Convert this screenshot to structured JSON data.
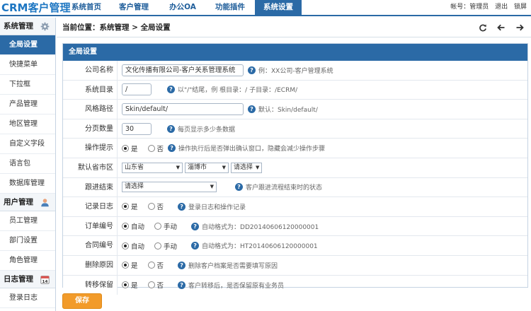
{
  "app": {
    "logo": "CRM客户管理"
  },
  "nav": {
    "tabs": [
      {
        "label": "系统首页"
      },
      {
        "label": "客户管理"
      },
      {
        "label": "办公OA"
      },
      {
        "label": "功能插件"
      },
      {
        "label": "系统设置",
        "active": true
      }
    ]
  },
  "user": {
    "account": "帐号：管理员",
    "logout": "退出",
    "lock": "锁屏"
  },
  "sidebar": {
    "groups": [
      {
        "title": "系统管理",
        "icon": "gear-icon",
        "items": [
          "全局设置",
          "快捷菜单",
          "下拉框",
          "产品管理",
          "地区管理",
          "自定义字段",
          "语言包",
          "数据库管理"
        ]
      },
      {
        "title": "用户管理",
        "icon": "user-icon",
        "items": [
          "员工管理",
          "部门设置",
          "角色管理"
        ]
      },
      {
        "title": "日志管理",
        "icon": "calendar-icon",
        "items": [
          "登录日志"
        ]
      }
    ],
    "active_item": "全局设置",
    "calendar_day": "14"
  },
  "breadcrumb": "当前位置：系统管理 > 全局设置",
  "panel": {
    "title": "全局设置",
    "rows": {
      "company": {
        "label": "公司名称",
        "value": "文化传播有限公司-客户关系管理系统",
        "hint": "例：XX公司-客户管理系统"
      },
      "sysdir": {
        "label": "系统目录",
        "value": "/",
        "hint": "以\"/\"结尾，例 根目录：/    子目录：/ECRM/"
      },
      "style": {
        "label": "风格路径",
        "value": "Skin/default/",
        "hint": "默认：Skin/default/"
      },
      "paging": {
        "label": "分页数量",
        "value": "30",
        "hint": "每页显示多少条数据"
      },
      "confirm": {
        "label": "操作提示",
        "yes": "是",
        "no": "否",
        "selected": "是",
        "hint": "操作执行后是否弹出确认窗口，隐藏会减少操作步骤"
      },
      "region": {
        "label": "默认省市区",
        "province": "山东省",
        "city": "淄博市",
        "district": "请选择"
      },
      "followup": {
        "label": "跟进结束",
        "value": "请选择",
        "hint": "客户跟进流程结束时的状态"
      },
      "log": {
        "label": "记录日志",
        "yes": "是",
        "no": "否",
        "selected": "是",
        "hint": "登录日志和操作记录"
      },
      "orderno": {
        "label": "订单编号",
        "auto": "自动",
        "manual": "手动",
        "selected": "自动",
        "hint": "自动格式为：DD20140606120000001"
      },
      "contractno": {
        "label": "合同编号",
        "auto": "自动",
        "manual": "手动",
        "selected": "自动",
        "hint": "自动格式为：HT20140606120000001"
      },
      "delete_reason": {
        "label": "删除原因",
        "yes": "是",
        "no": "否",
        "selected": "是",
        "hint": "删除客户档案是否需要填写原因"
      },
      "transfer": {
        "label": "转移保留",
        "yes": "是",
        "no": "否",
        "selected": "是",
        "hint": "客户转移后，是否保留原有业务员"
      }
    }
  },
  "save_label": "保存",
  "colors": {
    "primary": "#2b6aa6",
    "save": "#f29b2a",
    "logo": "#1d76c2"
  }
}
